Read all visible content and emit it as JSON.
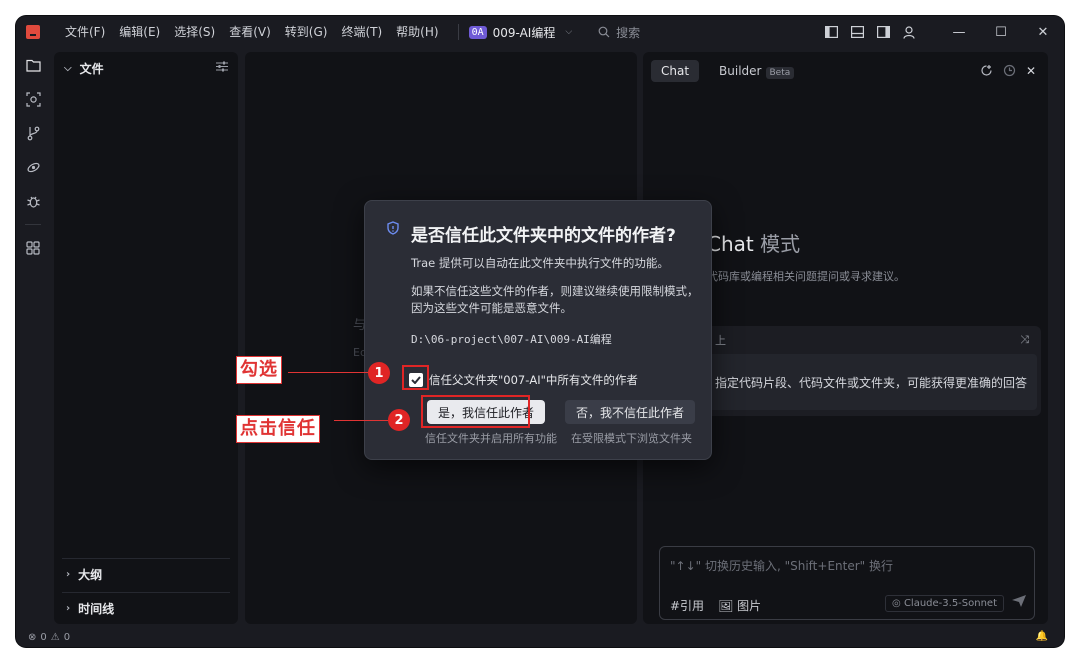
{
  "menu": [
    "文件(F)",
    "编辑(E)",
    "选择(S)",
    "查看(V)",
    "转到(G)",
    "终端(T)",
    "帮助(H)"
  ],
  "project": {
    "badge": "0A",
    "name": "009-AI编程"
  },
  "search": {
    "placeholder": "搜索"
  },
  "explorer": {
    "title": "文件",
    "outline": "大纲",
    "timeline": "时间线"
  },
  "editor_ghost": {
    "line1": "与",
    "line2": "Ec"
  },
  "chat": {
    "tab_chat": "Chat",
    "tab_builder": "Builder",
    "badge_beta": "Beta",
    "title_main": "Chat",
    "title_mode": "模式",
    "subtitle": "代码库或编程相关问题提问或寻求建议。",
    "tip_head": "上",
    "tip_text": "指定代码片段、代码文件或文件夹，可能获得更准确的回答",
    "input_placeholder": "\"↑↓\" 切换历史输入, \"Shift+Enter\" 换行",
    "ref": "#引用",
    "image": "图片",
    "model": "Claude-3.5-Sonnet"
  },
  "status": {
    "errors": "0",
    "warnings": "0"
  },
  "dialog": {
    "title": "是否信任此文件夹中的文件的作者?",
    "p1": "Trae 提供可以自动在此文件夹中执行文件的功能。",
    "p2": "如果不信任这些文件的作者，则建议继续使用限制模式，因为这些文件可能是恶意文件。",
    "path": "D:\\06-project\\007-AI\\009-AI编程",
    "checkbox_label": "信任父文件夹\"007-AI\"中所有文件的作者",
    "trust_button": "是，我信任此作者",
    "trust_hint": "信任文件夹并启用所有功能",
    "distrust_button": "否，我不信任此作者",
    "distrust_hint": "在受限模式下浏览文件夹"
  },
  "annotations": {
    "step1_label": "勾选",
    "step1_num": "1",
    "step2_label": "点击信任",
    "step2_num": "2"
  }
}
